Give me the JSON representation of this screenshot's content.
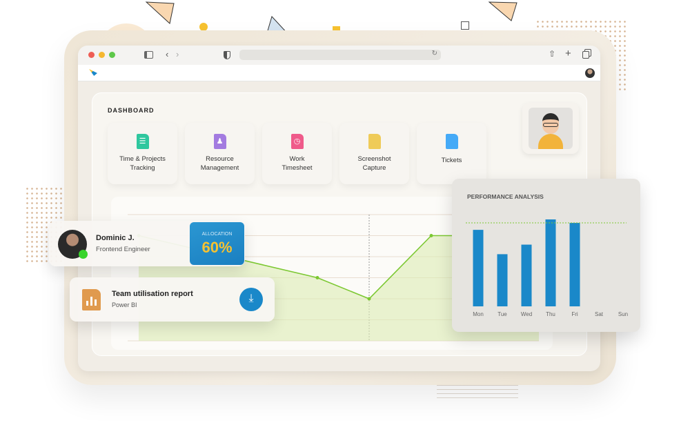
{
  "browser": {
    "traffic_lights": [
      "#ee5e55",
      "#f5b731",
      "#5fc84a"
    ]
  },
  "dashboard": {
    "title": "DASHBOARD",
    "cards": [
      {
        "label1": "Time & Projects",
        "label2": "Tracking",
        "icon": "document-list-icon",
        "color": "#2fc79e"
      },
      {
        "label1": "Resource",
        "label2": "Management",
        "icon": "team-icon",
        "color": "#a37be0"
      },
      {
        "label1": "Work",
        "label2": "Timesheet",
        "icon": "clock-icon",
        "color": "#ef5a8a"
      },
      {
        "label1": "Screenshot",
        "label2": "Capture",
        "icon": "file-icon",
        "color": "#efcb58"
      },
      {
        "label1": "Tickets",
        "label2": "",
        "icon": "file-icon",
        "color": "#45aaf7"
      }
    ]
  },
  "employee": {
    "name": "Dominic J.",
    "role": "Frontend Engineer",
    "status_color": "#39d42b",
    "allocation_label": "ALLOCATION",
    "allocation_value": "60%"
  },
  "report": {
    "title": "Team utilisation report",
    "subtitle": "Power BI",
    "icon": "bar-chart-file-icon",
    "action": "download-icon"
  },
  "chart_data": [
    {
      "type": "area",
      "series": [
        {
          "values": [
            5,
            3,
            2,
            5,
            5
          ]
        }
      ],
      "grid": true,
      "color": "#7cc832"
    },
    {
      "type": "bar",
      "title": "PERFORMANCE ANALYSIS",
      "categories": [
        "Mon",
        "Tue",
        "Wed",
        "Thu",
        "Fri",
        "Sat",
        "Sun"
      ],
      "values": [
        88,
        60,
        71,
        100,
        96,
        0,
        0
      ],
      "target": 96,
      "ylim": [
        0,
        100
      ],
      "color": "#1a88c9",
      "target_color": "#7cc832"
    }
  ]
}
